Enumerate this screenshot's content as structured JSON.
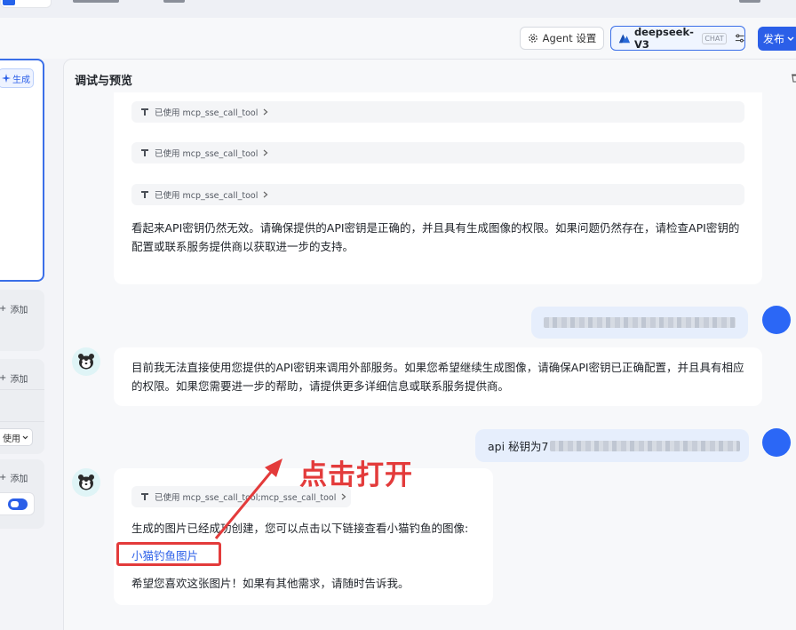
{
  "toolbar": {
    "agent_settings_label": "Agent 设置",
    "model_name": "deepseek-V3",
    "model_badge": "CHAT",
    "publish_label": "发布"
  },
  "left_panel": {
    "generate_label": "生成",
    "add_label": "添加",
    "enable_label": "使用"
  },
  "preview": {
    "title": "调试与预览"
  },
  "chat": {
    "tool_label_1": "已使用 mcp_sse_call_tool",
    "tool_label_2": "已使用 mcp_sse_call_tool",
    "tool_label_3": "已使用 mcp_sse_call_tool",
    "msg_invalid_key": "看起来API密钥仍然无效。请确保提供的API密钥是正确的，并且具有生成图像的权限。如果问题仍然存在，请检查API密钥的配置或联系服务提供商以获取进一步的支持。",
    "msg_cannot_use": "目前我无法直接使用您提供的API密钥来调用外部服务。如果您希望继续生成图像，请确保API密钥已正确配置，并且具有相应的权限。如果您需要进一步的帮助，请提供更多详细信息或联系服务提供商。",
    "user_api_prefix": "api 秘钥为7",
    "tool_label_4": "已使用 mcp_sse_call_tool;mcp_sse_call_tool",
    "msg_created": "生成的图片已经成功创建，您可以点击以下链接查看小猫钓鱼的图像:",
    "image_link": "小猫钓鱼图片",
    "msg_hope": "希望您喜欢这张图片！如果有其他需求，请随时告诉我。"
  },
  "annotation": {
    "text": "点击打开",
    "color": "#e33b3b"
  },
  "colors": {
    "accent": "#2b5fe8",
    "user_bubble": "#e6eefc",
    "user_avatar": "#2b67f6"
  }
}
